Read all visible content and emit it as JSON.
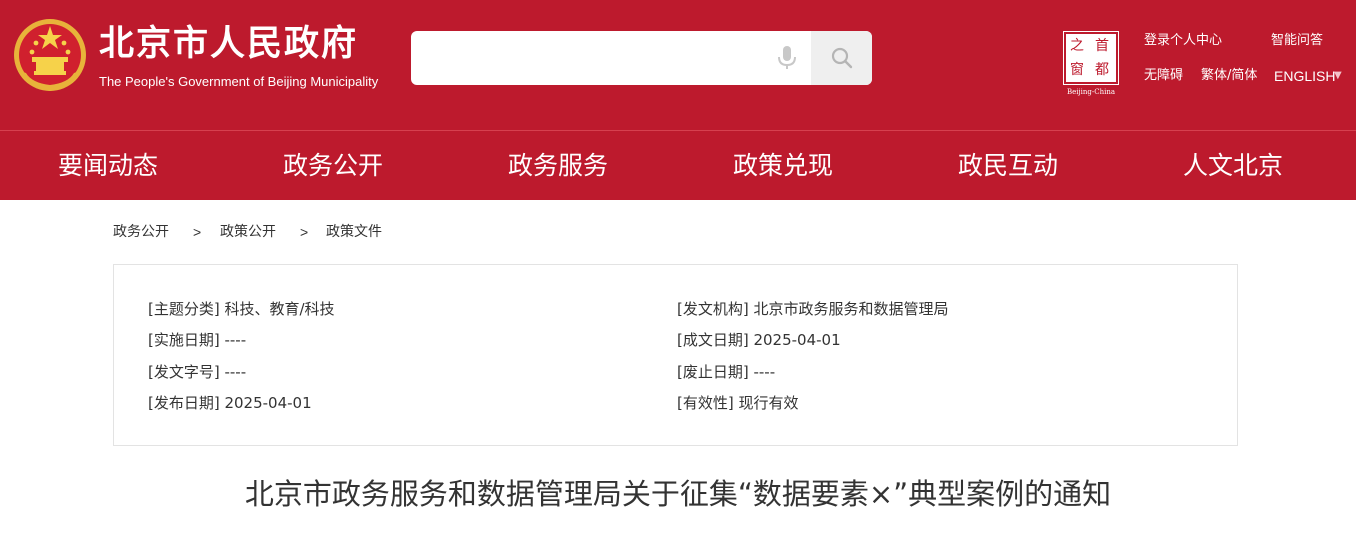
{
  "header": {
    "site_title": "北京市人民政府",
    "site_subtitle": "The People's Government of Beijing Municipality",
    "search": {
      "placeholder": ""
    },
    "seal": {
      "chars": [
        "之",
        "首",
        "窗",
        "都"
      ],
      "caption": "Beijing-China"
    },
    "utility_links": {
      "login": "登录个人中心",
      "smart_qa": "智能问答",
      "accessibility": "无障碍",
      "trad_simp": "繁体/简体",
      "english": "ENGLISH",
      "english_caret": "▼"
    },
    "colors": {
      "brand_red": "#bd1a2d"
    }
  },
  "nav": {
    "items": [
      "要闻动态",
      "政务公开",
      "政务服务",
      "政策兑现",
      "政民互动",
      "人文北京"
    ]
  },
  "breadcrumb": {
    "items": [
      "政务公开",
      "政策公开",
      "政策文件"
    ],
    "separator": ">"
  },
  "doc_meta": {
    "left": [
      "[主题分类] 科技、教育/科技",
      "[实施日期] ----",
      "[发文字号] ----",
      "[发布日期] 2025-04-01"
    ],
    "right": [
      "[发文机构] 北京市政务服务和数据管理局",
      "[成文日期] 2025-04-01",
      "[废止日期] ----",
      "[有效性] 现行有效"
    ]
  },
  "document": {
    "title": "北京市政务服务和数据管理局关于征集“数据要素×”典型案例的通知"
  }
}
